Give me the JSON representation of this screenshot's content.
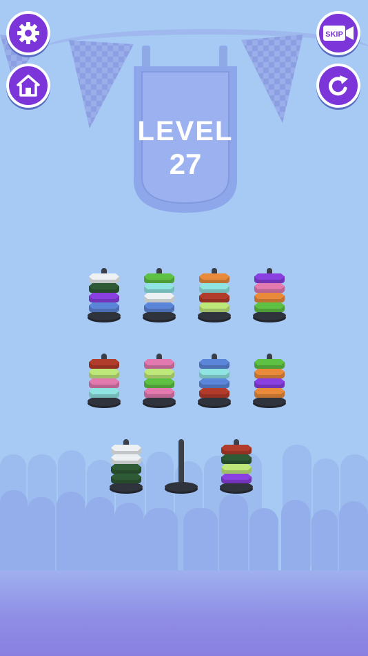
{
  "level": {
    "label": "LEVEL",
    "number": "27"
  },
  "buttons": {
    "settings": {
      "icon": "gear-icon"
    },
    "home": {
      "icon": "home-icon"
    },
    "skip": {
      "icon": "skip-video-icon",
      "label": "SKIP"
    },
    "restart": {
      "icon": "restart-icon"
    }
  },
  "colors": {
    "accent": "#7c35d9",
    "background": "#a6caf3",
    "white": "#eef1f3",
    "dark-green": "#2f5a36",
    "purple": "#8a3fe0",
    "blue": "#5b85d8",
    "green": "#5fc144",
    "light-cyan": "#8fe3e0",
    "orange": "#e88a3a",
    "red": "#b23c2b",
    "lime": "#bfe87a",
    "pink": "#e27ab0"
  },
  "pegs": [
    {
      "rings": [
        "white",
        "dark-green",
        "purple",
        "blue"
      ]
    },
    {
      "rings": [
        "green",
        "light-cyan",
        "white",
        "blue"
      ]
    },
    {
      "rings": [
        "orange",
        "light-cyan",
        "red",
        "lime"
      ]
    },
    {
      "rings": [
        "purple",
        "pink",
        "orange",
        "green"
      ]
    },
    {
      "rings": [
        "red",
        "lime",
        "pink",
        "light-cyan"
      ]
    },
    {
      "rings": [
        "pink",
        "lime",
        "green",
        "pink"
      ]
    },
    {
      "rings": [
        "blue",
        "light-cyan",
        "blue",
        "red"
      ]
    },
    {
      "rings": [
        "green",
        "orange",
        "purple",
        "orange"
      ]
    },
    {
      "rings": [
        "white",
        "white",
        "dark-green",
        "dark-green"
      ]
    },
    {
      "rings": []
    },
    {
      "rings": [
        "red",
        "dark-green",
        "lime",
        "purple"
      ]
    }
  ]
}
